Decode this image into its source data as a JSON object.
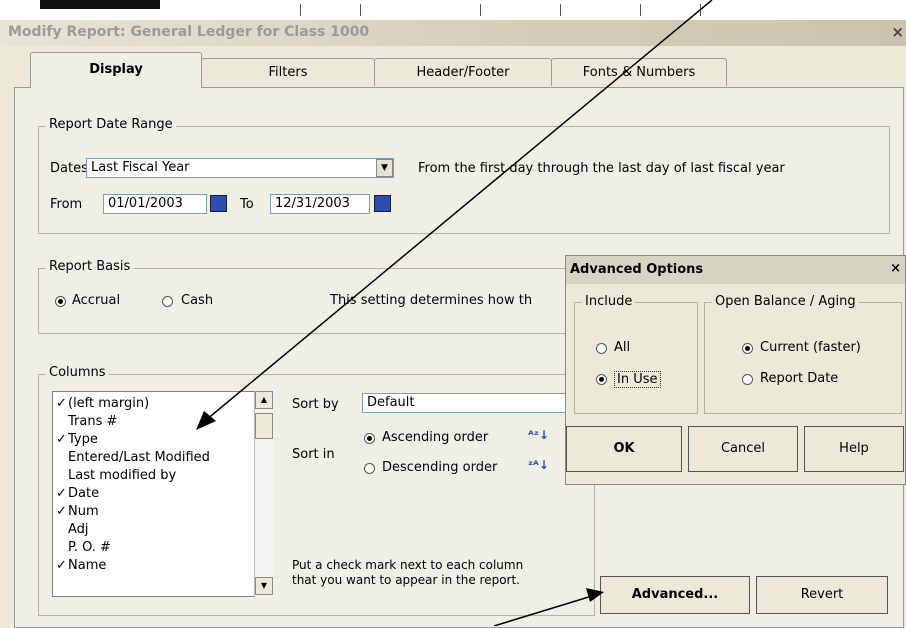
{
  "window": {
    "title": "Modify Report: General Ledger for Class 1000",
    "close": "×"
  },
  "tabs": [
    "Display",
    "Filters",
    "Header/Footer",
    "Fonts & Numbers"
  ],
  "report_date_range": {
    "group_label": "Report Date Range",
    "dates_label": "Dates",
    "dates_value": "Last Fiscal Year",
    "description": "From the first day through the last day of last fiscal year",
    "from_label": "From",
    "from_value": "01/01/2003",
    "to_label": "To",
    "to_value": "12/31/2003"
  },
  "report_basis": {
    "group_label": "Report Basis",
    "accrual": "Accrual",
    "cash": "Cash",
    "description": "This setting determines how th"
  },
  "columns": {
    "group_label": "Columns",
    "items": [
      {
        "label": "(left margin)",
        "checked": true
      },
      {
        "label": "Trans #",
        "checked": false
      },
      {
        "label": "Type",
        "checked": true
      },
      {
        "label": "Entered/Last Modified",
        "checked": false
      },
      {
        "label": "Last modified by",
        "checked": false
      },
      {
        "label": "Date",
        "checked": true
      },
      {
        "label": "Num",
        "checked": true
      },
      {
        "label": "Adj",
        "checked": false
      },
      {
        "label": "P. O. #",
        "checked": false
      },
      {
        "label": "Name",
        "checked": true
      }
    ],
    "check_glyph": "✓",
    "sort_by_label": "Sort by",
    "sort_by_value": "Default",
    "sort_in_label": "Sort in",
    "ascending": "Ascending order",
    "descending": "Descending order",
    "hint_line1": "Put a check mark next to each column",
    "hint_line2": "that you want to appear in the report."
  },
  "buttons": {
    "advanced": "Advanced...",
    "revert": "Revert"
  },
  "advanced_options": {
    "title": "Advanced Options",
    "close": "×",
    "include_label": "Include",
    "all": "All",
    "in_use": "In Use",
    "open_balance_label": "Open Balance / Aging",
    "current": "Current (faster)",
    "report_date": "Report Date",
    "ok": "OK",
    "cancel": "Cancel",
    "help": "Help"
  },
  "colors": {
    "accent": "#2f4db0",
    "panel": "#f0efe6",
    "dialog_title": "#d8d4c4"
  }
}
